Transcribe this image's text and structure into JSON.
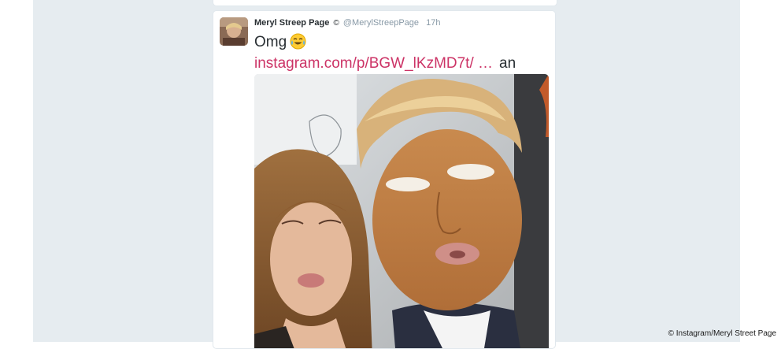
{
  "tweet": {
    "author_name": "Meryl Streep Page",
    "verified_glyph": "©",
    "handle": "@MerylStreepPage",
    "time": "17h",
    "text": "Omg",
    "emoji": "face-with-tears-of-joy-icon",
    "link_text": "instagram.com/p/BGW_lKzMD7t/ …",
    "suffix": "an"
  },
  "credit": "© Instagram/Meryl Street Page",
  "colors": {
    "link": "#cc3366",
    "page_background": "#e6ecf0",
    "card_border": "#e1e8ed",
    "name_text": "#292f33",
    "muted_text": "#8899a6"
  }
}
